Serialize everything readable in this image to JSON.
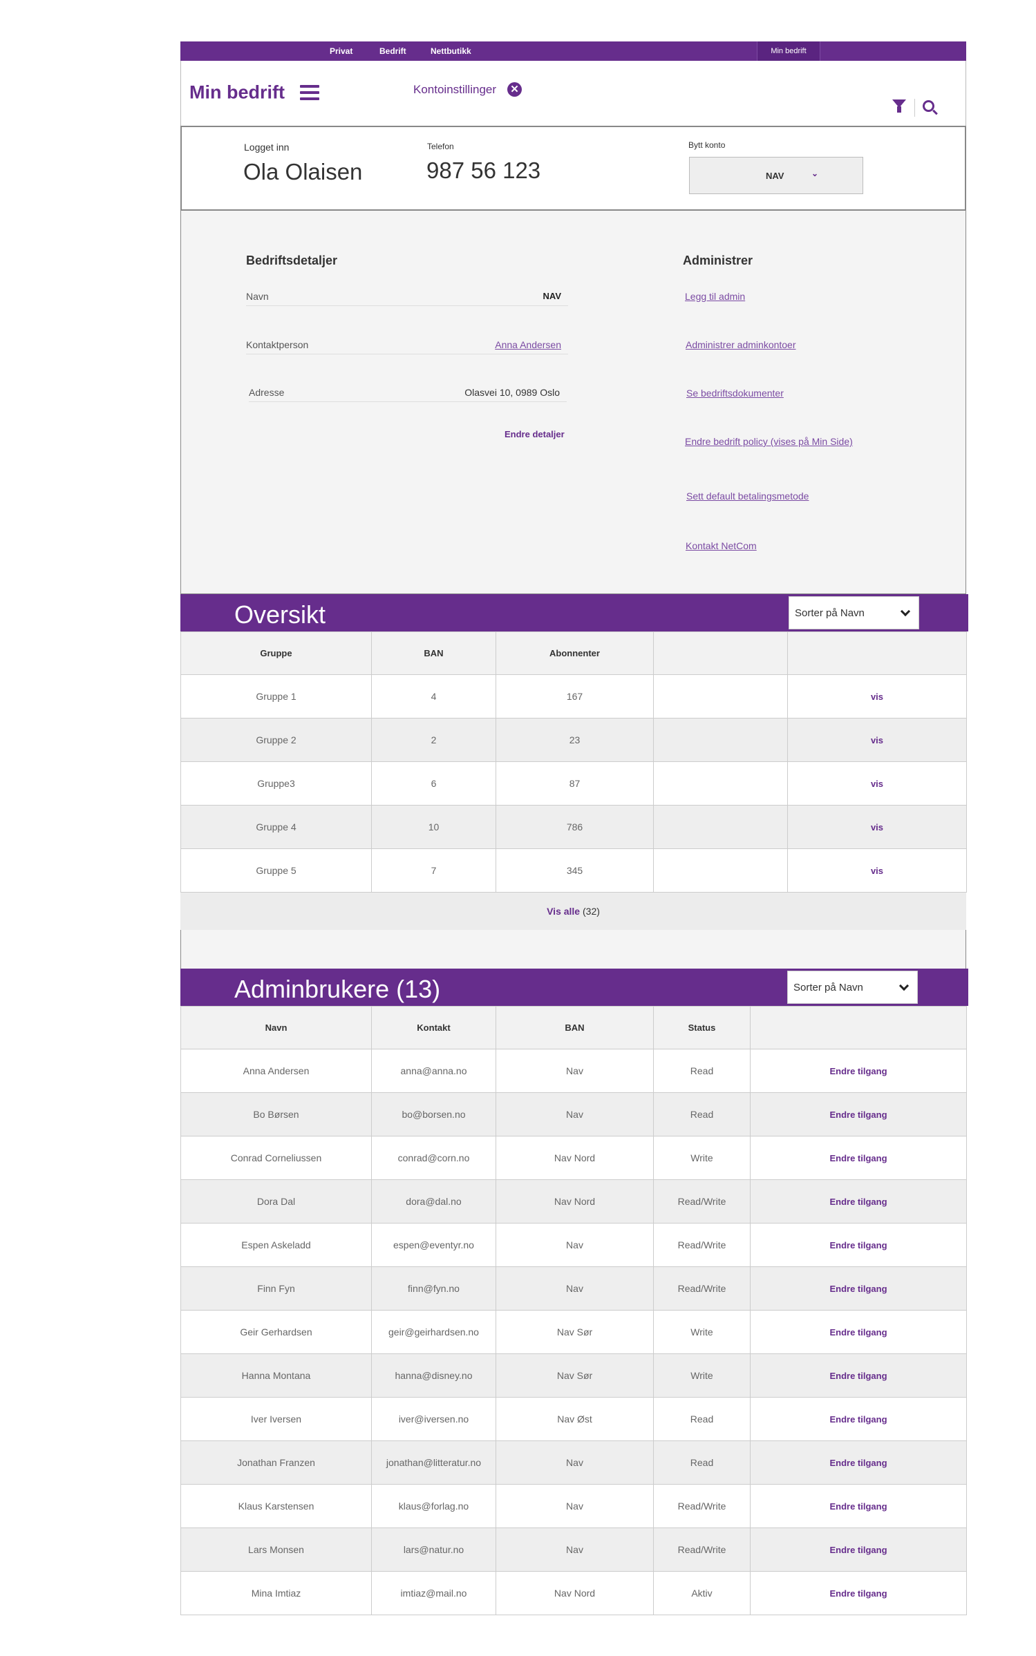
{
  "topnav": {
    "links": [
      "Privat",
      "Bedrift",
      "Nettbutikk"
    ],
    "active": "Min bedrift"
  },
  "header": {
    "brand": "Min bedrift",
    "konto": "Kontoinstillinger",
    "close_glyph": "✕"
  },
  "account": {
    "logged_label": "Logget inn",
    "name": "Ola Olaisen",
    "phone_label": "Telefon",
    "phone": "987 56 123",
    "switch_label": "Bytt konto",
    "switch_value": "NAV"
  },
  "details": {
    "title": "Bedriftsdetaljer",
    "rows": [
      {
        "label": "Navn",
        "value": "NAV"
      },
      {
        "label": "Kontaktperson",
        "value": "Anna Andersen"
      },
      {
        "label": "Adresse",
        "value": "Olasvei 10, 0989 Oslo"
      }
    ],
    "edit": "Endre detaljer"
  },
  "admin": {
    "title": "Administrer",
    "links": [
      "Legg til admin",
      "Administrer adminkontoer",
      "Se bedriftsdokumenter",
      "Endre bedrift policy (vises på Min Side)",
      "Sett default betalingsmetode",
      "Kontakt NetCom"
    ]
  },
  "overview": {
    "title": "Oversikt",
    "sort": "Sorter på Navn",
    "columns": [
      "Gruppe",
      "BAN",
      "Abonnenter",
      "",
      ""
    ],
    "rows": [
      [
        "Gruppe 1",
        "4",
        "167",
        "",
        "vis"
      ],
      [
        "Gruppe 2",
        "2",
        "23",
        "",
        "vis"
      ],
      [
        "Gruppe3",
        "6",
        "87",
        "",
        "vis"
      ],
      [
        "Gruppe 4",
        "10",
        "786",
        "",
        "vis"
      ],
      [
        "Gruppe 5",
        "7",
        "345",
        "",
        "vis"
      ]
    ],
    "show_all": "Vis alle",
    "show_all_count": "(32)"
  },
  "admins": {
    "title": "Adminbrukere (13)",
    "sort": "Sorter på Navn",
    "columns": [
      "Navn",
      "Kontakt",
      "BAN",
      "Status",
      ""
    ],
    "rows": [
      [
        "Anna Andersen",
        "anna@anna.no",
        "Nav",
        "Read",
        "Endre tilgang"
      ],
      [
        "Bo Børsen",
        "bo@borsen.no",
        "Nav",
        "Read",
        "Endre tilgang"
      ],
      [
        "Conrad Corneliussen",
        "conrad@corn.no",
        "Nav Nord",
        "Write",
        "Endre tilgang"
      ],
      [
        "Dora Dal",
        "dora@dal.no",
        "Nav Nord",
        "Read/Write",
        "Endre tilgang"
      ],
      [
        "Espen Askeladd",
        "espen@eventyr.no",
        "Nav",
        "Read/Write",
        "Endre tilgang"
      ],
      [
        "Finn Fyn",
        "finn@fyn.no",
        "Nav",
        "Read/Write",
        "Endre tilgang"
      ],
      [
        "Geir Gerhardsen",
        "geir@geirhardsen.no",
        "Nav Sør",
        "Write",
        "Endre tilgang"
      ],
      [
        "Hanna Montana",
        "hanna@disney.no",
        "Nav Sør",
        "Write",
        "Endre tilgang"
      ],
      [
        "Iver Iversen",
        "iver@iversen.no",
        "Nav Øst",
        "Read",
        "Endre tilgang"
      ],
      [
        "Jonathan Franzen",
        "jonathan@litteratur.no",
        "Nav",
        "Read",
        "Endre tilgang"
      ],
      [
        "Klaus Karstensen",
        "klaus@forlag.no",
        "Nav",
        "Read/Write",
        "Endre tilgang"
      ],
      [
        "Lars Monsen",
        "lars@natur.no",
        "Nav",
        "Read/Write",
        "Endre tilgang"
      ],
      [
        "Mina Imtiaz",
        "imtiaz@mail.no",
        "Nav Nord",
        "Aktiv",
        "Endre tilgang"
      ]
    ]
  },
  "colors": {
    "brand": "#662d8c",
    "link": "#7b4ba3"
  }
}
